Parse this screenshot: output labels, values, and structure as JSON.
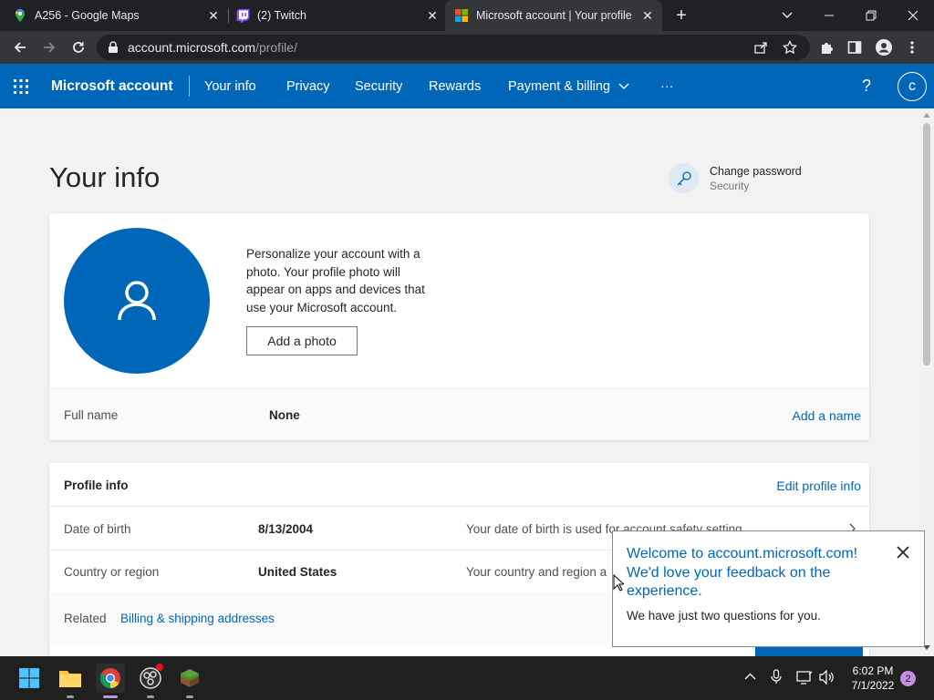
{
  "browser": {
    "tabs": [
      {
        "title": "A256 - Google Maps",
        "icon": "google-maps-icon"
      },
      {
        "title": "(2) Twitch",
        "icon": "twitch-icon"
      },
      {
        "title": "Microsoft account | Your profile",
        "icon": "microsoft-icon"
      }
    ],
    "url_host": "account.microsoft.com",
    "url_path": "/profile/"
  },
  "header": {
    "brand": "Microsoft account",
    "nav": [
      "Your info",
      "Privacy",
      "Security",
      "Rewards",
      "Payment & billing"
    ],
    "more": "···",
    "help": "?",
    "avatar_initial": "c"
  },
  "page": {
    "title": "Your info",
    "change_password": {
      "title": "Change password",
      "subtitle": "Security"
    },
    "photo": {
      "description": "Personalize your account with a photo. Your profile photo will appear on apps and devices that use your Microsoft account.",
      "button": "Add a photo"
    },
    "full_name": {
      "label": "Full name",
      "value": "None",
      "action": "Add a name"
    },
    "profile_info": {
      "title": "Profile info",
      "action": "Edit profile info",
      "rows": [
        {
          "label": "Date of birth",
          "value": "8/13/2004",
          "note": "Your date of birth is used for account safety setting"
        },
        {
          "label": "Country or region",
          "value": "United States",
          "note": "Your country and region a"
        }
      ],
      "related_label": "Related",
      "related_link": "Billing & shipping addresses"
    }
  },
  "popup": {
    "heading": "Welcome to account.microsoft.com! We'd love your feedback on the experience.",
    "body": "We have just two questions for you."
  },
  "taskbar": {
    "time": "6:02 PM",
    "date": "7/1/2022",
    "notification_count": "2"
  },
  "colors": {
    "brand_blue": "#0067b8",
    "chrome_dark": "#202124",
    "page_bg": "#f2f2f2"
  }
}
